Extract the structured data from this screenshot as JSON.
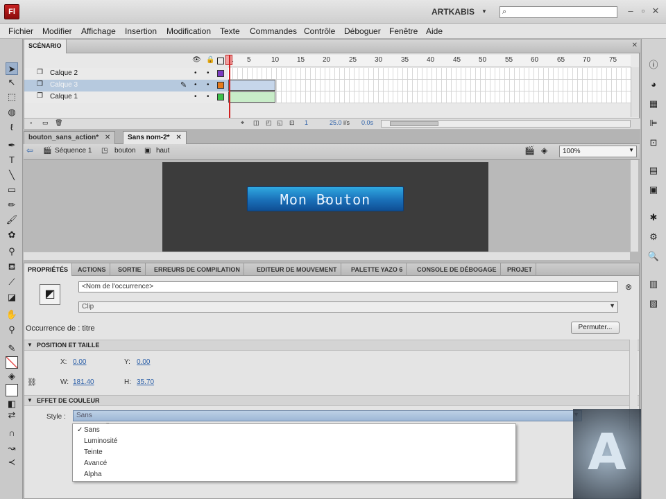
{
  "app": {
    "logo_text": "Fl",
    "workspace": "ARTKABIS",
    "search_placeholder": ""
  },
  "menu": [
    "Fichier",
    "Modifier",
    "Affichage",
    "Insertion",
    "Modification",
    "Texte",
    "Commandes",
    "Contrôle",
    "Déboguer",
    "Fenêtre",
    "Aide"
  ],
  "timeline": {
    "tab": "SCÉNARIO",
    "ticks": [
      "1",
      "5",
      "10",
      "15",
      "20",
      "25",
      "30",
      "35",
      "40",
      "45",
      "50",
      "55",
      "60",
      "65",
      "70",
      "75"
    ],
    "layers": [
      {
        "name": "Calque 2",
        "color": "#7a3cc0"
      },
      {
        "name": "Calque 3",
        "color": "#e67a1a"
      },
      {
        "name": "Calque 1",
        "color": "#3cc04a"
      }
    ],
    "footer": {
      "frame": "1",
      "fps": "25.0",
      "fps_unit": "i/s",
      "time": "0.0s"
    }
  },
  "doc_tabs": [
    {
      "label": "bouton_sans_action*",
      "active": false
    },
    {
      "label": "Sans nom-2*",
      "active": true
    }
  ],
  "breadcrumb": [
    "Séquence 1",
    "bouton",
    "haut"
  ],
  "zoom": "100%",
  "stage": {
    "button_label": "Mon Bouton"
  },
  "properties": {
    "tabs": [
      "PROPRIÉTÉS",
      "ACTIONS",
      "SORTIE",
      "ERREURS DE COMPILATION",
      "EDITEUR DE MOUVEMENT",
      "PALETTE YAZO 6",
      "CONSOLE DE DÉBOGAGE",
      "PROJET"
    ],
    "instance_name_placeholder": "<Nom de l'occurrence>",
    "instance_type": "Clip",
    "occurrence": "Occurrence de : titre",
    "swap_button": "Permuter...",
    "position_section": "POSITION ET TAILLE",
    "x_label": "X:",
    "x_value": "0.00",
    "y_label": "Y:",
    "y_value": "0.00",
    "w_label": "W:",
    "w_value": "181.40",
    "h_label": "H:",
    "h_value": "35.70",
    "color_section": "EFFET DE COULEUR",
    "style_label": "Style :",
    "style_value": "Sans",
    "style_options": [
      "Sans",
      "Luminosité",
      "Teinte",
      "Avancé",
      "Alpha"
    ]
  }
}
